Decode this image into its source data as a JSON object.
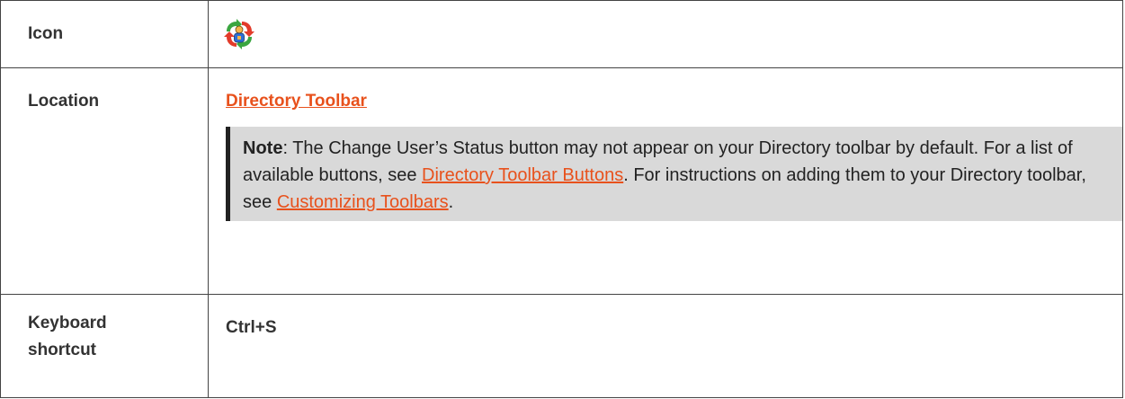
{
  "table": {
    "icon_label": "Icon",
    "icon_name": "change-user-status-icon",
    "location_label": "Location",
    "location_link": "Directory Toolbar",
    "note": {
      "lead": "Note",
      "text1": ": The Change User’s Status button may not appear on your Directory toolbar by default. For a list of available buttons, see ",
      "link1": "Directory Toolbar Buttons",
      "text2": ". For instructions on adding them to your Directory toolbar, see ",
      "link2": "Customizing Toolbars",
      "text3": "."
    },
    "keyboard_label_line1": "Keyboard",
    "keyboard_label_line2": "shortcut",
    "keyboard_value": "Ctrl+S"
  },
  "colors": {
    "link": "#e8511c",
    "note_bg": "#d9d9d9"
  }
}
